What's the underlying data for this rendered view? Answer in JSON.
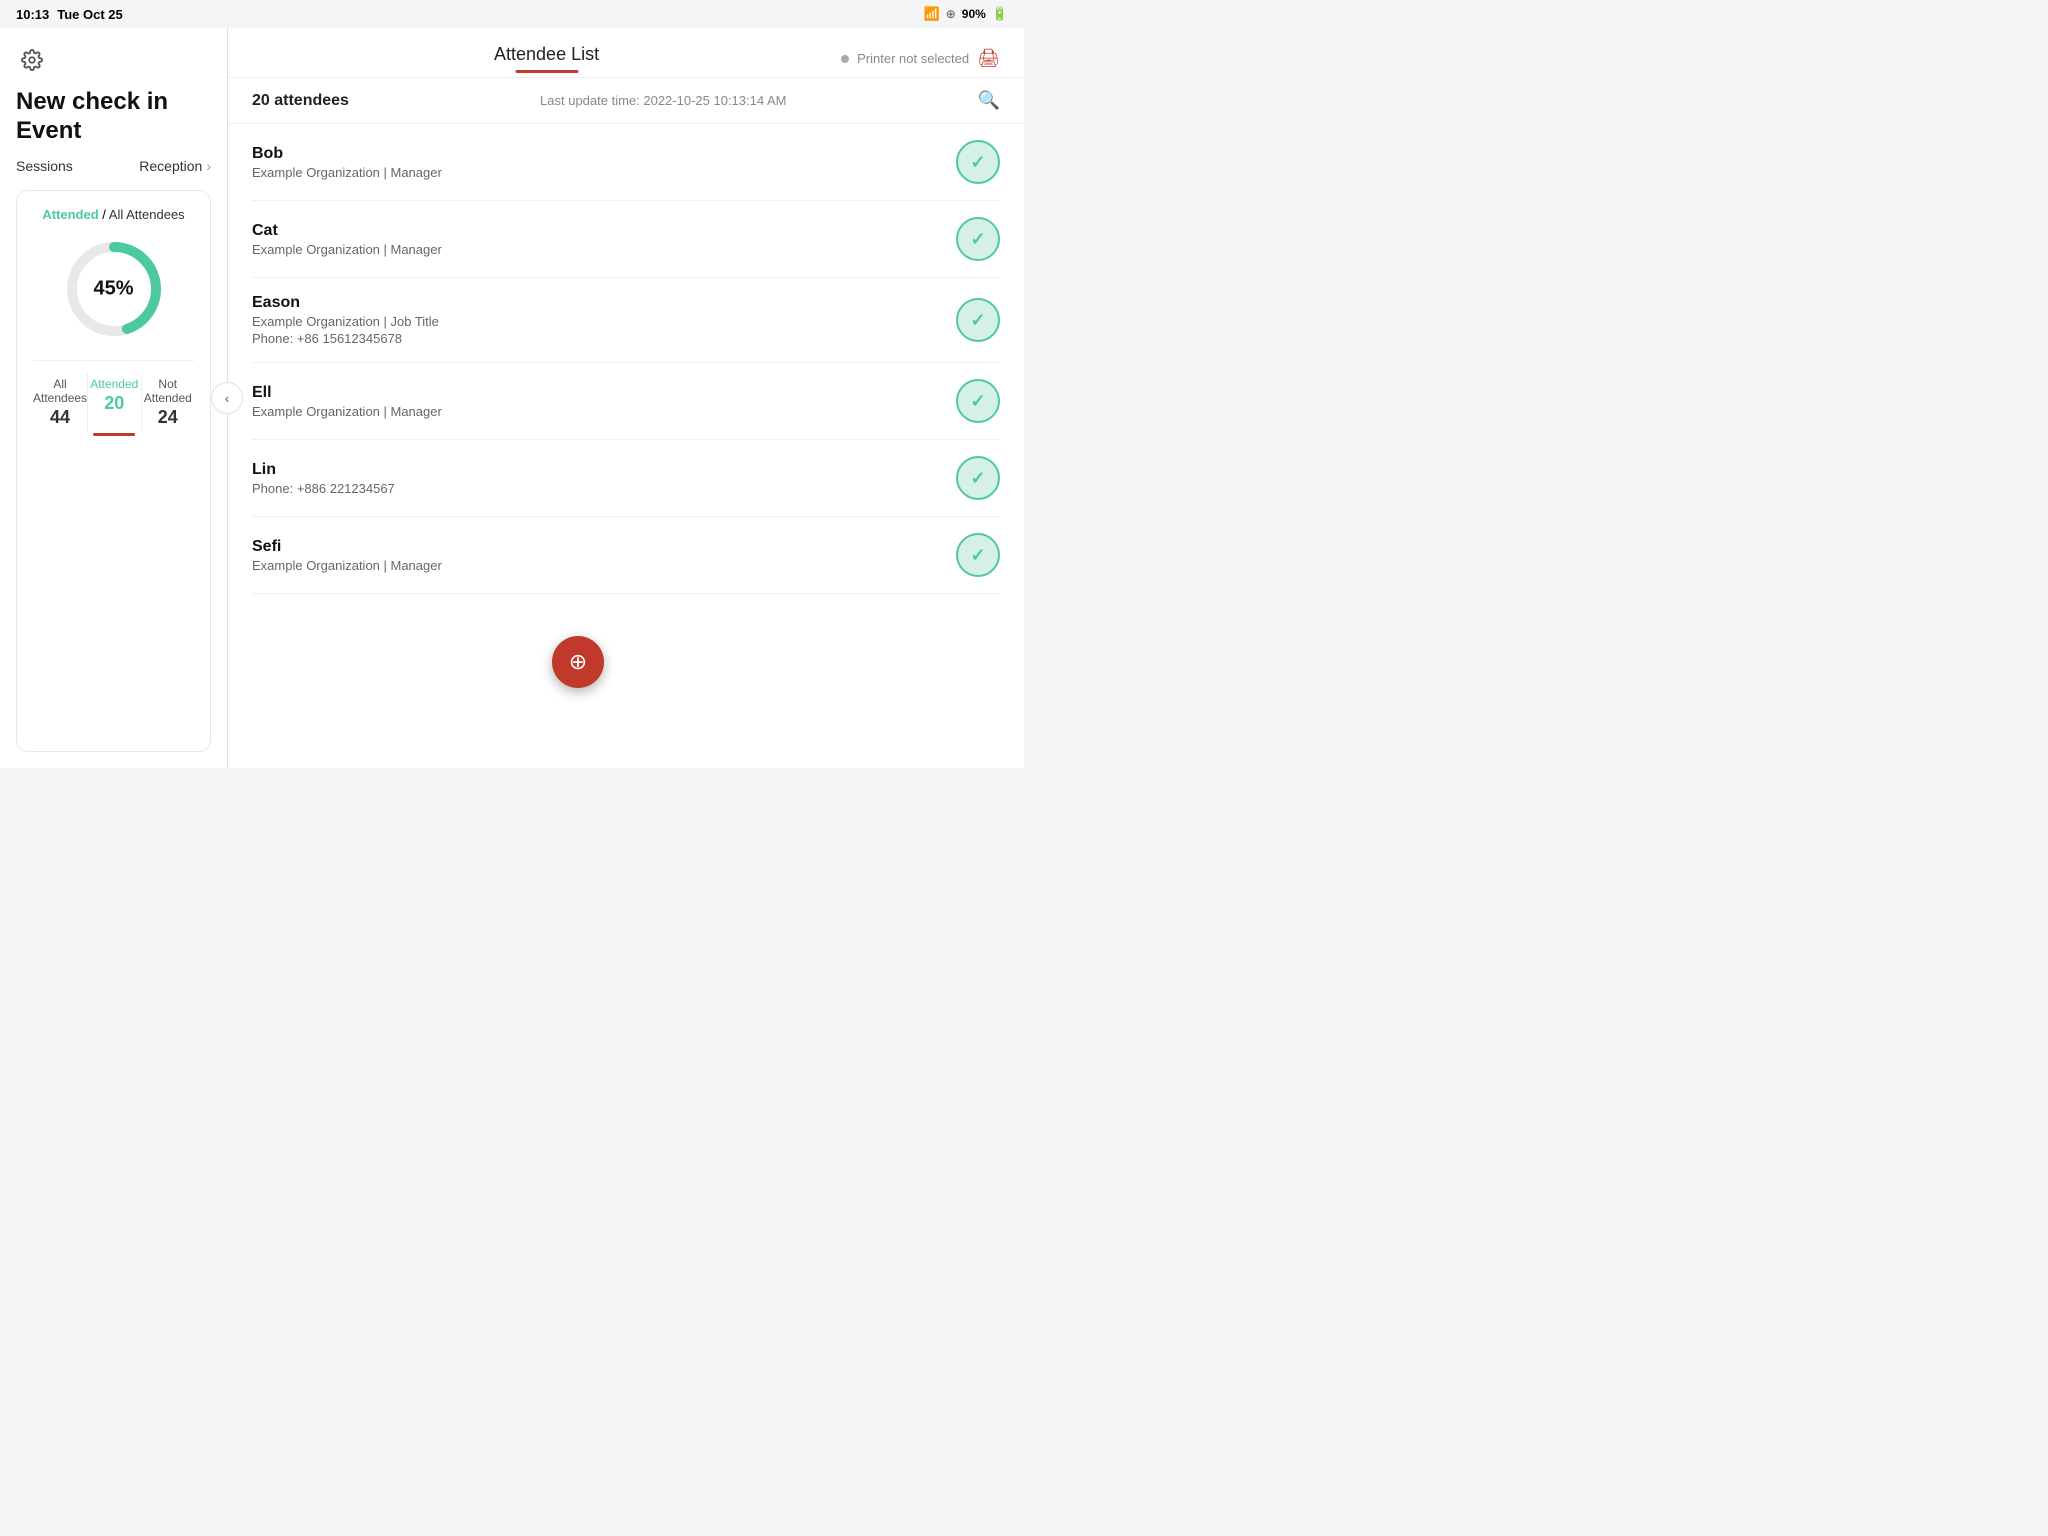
{
  "statusBar": {
    "time": "10:13",
    "date": "Tue Oct 25",
    "battery": "90%"
  },
  "leftPanel": {
    "eventTitle": "New check in Event",
    "sessionsLabel": "Sessions",
    "receptionLabel": "Reception",
    "statsHeader": {
      "attendedLabel": "Attended",
      "separator": " / ",
      "allLabel": "All Attendees"
    },
    "donut": {
      "percentage": "45%",
      "attendedPercent": 45
    },
    "tabs": [
      {
        "label": "All Attendees",
        "value": "44"
      },
      {
        "label": "Attended",
        "value": "20"
      },
      {
        "label": "Not Attended",
        "value": "24"
      }
    ]
  },
  "rightPanel": {
    "title": "Attendee List",
    "printerText": "Printer not selected",
    "attendeeCount": "20 attendees",
    "lastUpdate": "Last update time: 2022-10-25 10:13:14 AM",
    "attendees": [
      {
        "name": "Bob",
        "org": "Example Organization | Manager",
        "phone": null
      },
      {
        "name": "Cat",
        "org": "Example Organization | Manager",
        "phone": null
      },
      {
        "name": "Eason",
        "org": "Example Organization | Job Title",
        "phone": "Phone: +86 15612345678"
      },
      {
        "name": "Ell",
        "org": "Example Organization | Manager",
        "phone": null
      },
      {
        "name": "Lin",
        "org": null,
        "phone": "Phone: +886 221234567"
      },
      {
        "name": "Sefi",
        "org": "Example Organization | Manager",
        "phone": null
      }
    ]
  }
}
